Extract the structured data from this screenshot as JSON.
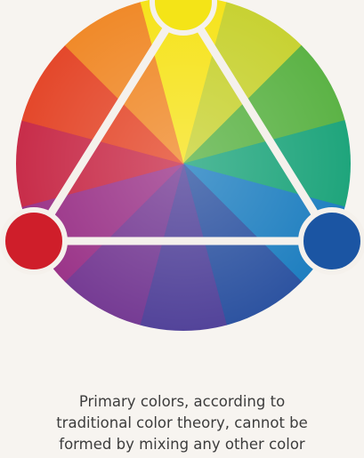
{
  "diagram": {
    "wheel_segment_colors": [
      "#f6e31c",
      "#c8d233",
      "#5cb346",
      "#1fa57c",
      "#1f7fc0",
      "#2e54a1",
      "#53449a",
      "#763c94",
      "#9b3589",
      "#c82d4a",
      "#e4482b",
      "#f08a2a"
    ],
    "triangle_line_color": "#f5f1ec",
    "primary_colors": [
      {
        "name": "yellow",
        "color": "#f4e417"
      },
      {
        "name": "red",
        "color": "#cf1e2a"
      },
      {
        "name": "blue",
        "color": "#1b55a3"
      }
    ]
  },
  "caption": {
    "line1": "Primary colors, according to",
    "line2": "traditional color theory, cannot be",
    "line3": "formed by mixing any other color"
  }
}
